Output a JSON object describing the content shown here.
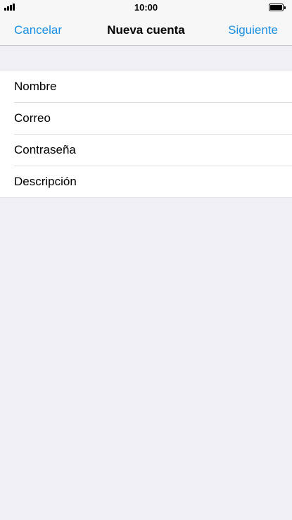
{
  "status_bar": {
    "time": "10:00",
    "signal_icon": "cellular-signal-icon",
    "battery_icon": "battery-icon",
    "battery_level": 1.0
  },
  "nav": {
    "cancel_label": "Cancelar",
    "title": "Nueva cuenta",
    "next_label": "Siguiente",
    "accent_color": "#1a8fe3"
  },
  "form": {
    "fields": [
      {
        "placeholder": "Nombre",
        "value": ""
      },
      {
        "placeholder": "Correo",
        "value": ""
      },
      {
        "placeholder": "Contraseña",
        "value": ""
      },
      {
        "placeholder": "Descripción",
        "value": ""
      }
    ]
  },
  "colors": {
    "background": "#efeff4",
    "bar_background": "#f7f7f7",
    "cell_background": "#ffffff"
  }
}
